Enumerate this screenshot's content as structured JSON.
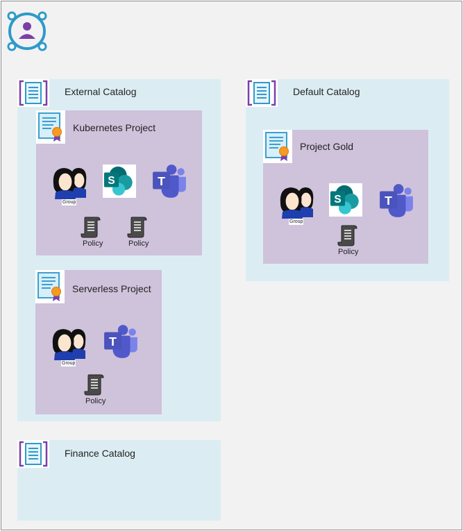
{
  "catalogs": [
    {
      "name": "External Catalog"
    },
    {
      "name": "Default Catalog"
    },
    {
      "name": "Finance Catalog"
    }
  ],
  "projects": [
    {
      "name": "Kubernetes Project",
      "group_label": "Group",
      "policies": [
        "Policy",
        "Policy"
      ]
    },
    {
      "name": "Serverless Project",
      "group_label": "Group",
      "policies": [
        "Policy"
      ]
    },
    {
      "name": "Project Gold",
      "group_label": "Group",
      "policies": [
        "Policy"
      ]
    }
  ],
  "colors": {
    "catalog_bg": "#dbedf3",
    "project_bg": "#cfc2db",
    "teams_purple": "#5558af",
    "sharepoint_teal": "#03787c"
  },
  "icons": {
    "root": "user-network-icon",
    "catalog": "catalog-icon",
    "project": "certificate-icon",
    "group": "group-icon",
    "sharepoint": "sharepoint-icon",
    "teams": "teams-icon",
    "policy": "policy-scroll-icon"
  }
}
